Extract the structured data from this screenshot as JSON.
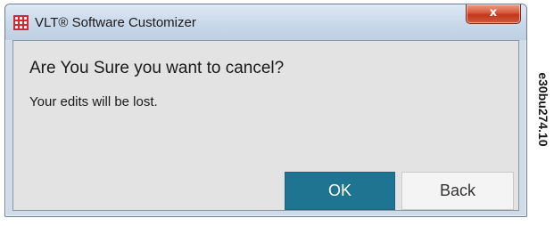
{
  "window": {
    "title": "VLT® Software Customizer",
    "close_label": "x",
    "app_icon": "grid-logo-icon"
  },
  "dialog": {
    "heading": "Are You Sure you want to cancel?",
    "message": "Your edits will be lost.",
    "ok_label": "OK",
    "back_label": "Back"
  },
  "figure_code": "e30bu274.10",
  "colors": {
    "ok_button": "#1f7591",
    "back_button": "#f4f4f4",
    "close_button": "#c2371c",
    "dialog_background": "#e3e3e3",
    "logo_red": "#d7262e"
  }
}
